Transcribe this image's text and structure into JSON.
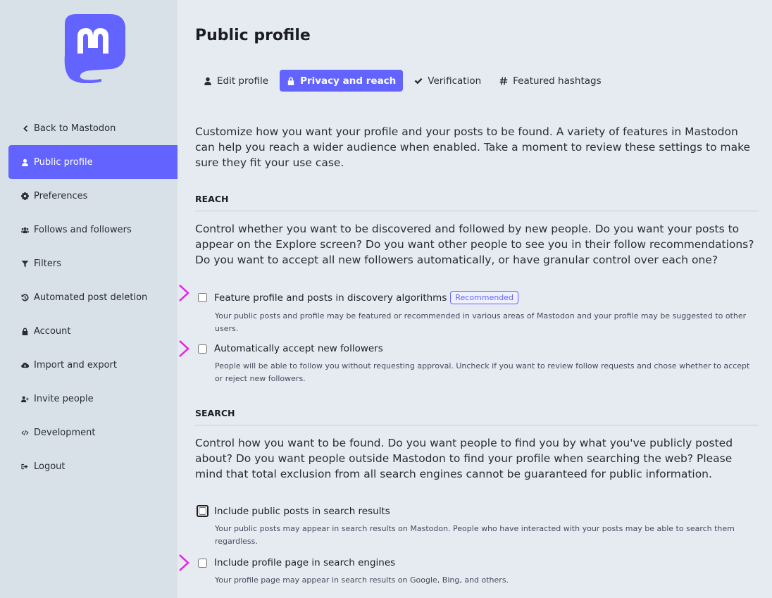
{
  "sidebar": {
    "items": [
      {
        "label": "Back to Mastodon",
        "icon": "chevron-left-icon"
      },
      {
        "label": "Public profile",
        "icon": "user-icon",
        "active": true
      },
      {
        "label": "Preferences",
        "icon": "gear-icon"
      },
      {
        "label": "Follows and followers",
        "icon": "users-icon"
      },
      {
        "label": "Filters",
        "icon": "filter-icon"
      },
      {
        "label": "Automated post deletion",
        "icon": "history-icon"
      },
      {
        "label": "Account",
        "icon": "lock-icon"
      },
      {
        "label": "Import and export",
        "icon": "cloud-download-icon"
      },
      {
        "label": "Invite people",
        "icon": "user-plus-icon"
      },
      {
        "label": "Development",
        "icon": "code-icon"
      },
      {
        "label": "Logout",
        "icon": "sign-out-icon"
      }
    ]
  },
  "page": {
    "title": "Public profile",
    "tabs": [
      {
        "label": "Edit profile",
        "icon": "user-icon"
      },
      {
        "label": "Privacy and reach",
        "icon": "lock-icon",
        "active": true
      },
      {
        "label": "Verification",
        "icon": "check-icon"
      },
      {
        "label": "Featured hashtags",
        "icon": "hashtag-icon"
      }
    ],
    "intro": "Customize how you want your profile and your posts to be found. A variety of features in Mastodon can help you reach a wider audience when enabled. Take a moment to review these settings to make sure they fit your use case."
  },
  "reach": {
    "title": "REACH",
    "description": "Control whether you want to be discovered and followed by new people. Do you want your posts to appear on the Explore screen? Do you want other people to see you in their follow recommendations? Do you want to accept all new followers automatically, or have granular control over each one?",
    "options": [
      {
        "label": "Feature profile and posts in discovery algorithms",
        "badge": "Recommended",
        "hint": "Your public posts and profile may be featured or recommended in various areas of Mastodon and your profile may be suggested to other users.",
        "checked": false
      },
      {
        "label": "Automatically accept new followers",
        "hint": "People will be able to follow you without requesting approval. Uncheck if you want to review follow requests and chose whether to accept or reject new followers.",
        "checked": false
      }
    ]
  },
  "search": {
    "title": "SEARCH",
    "description": "Control how you want to be found. Do you want people to find you by what you've publicly posted about? Do you want people outside Mastodon to find your profile when searching the web? Please mind that total exclusion from all search engines cannot be guaranteed for public information.",
    "options": [
      {
        "label": "Include public posts in search results",
        "hint": "Your public posts may appear in search results on Mastodon. People who have interacted with your posts may be able to search them regardless.",
        "checked": false
      },
      {
        "label": "Include profile page in search engines",
        "hint": "Your profile page may appear in search results on Google, Bing, and others.",
        "checked": false
      }
    ]
  },
  "colors": {
    "accent": "#6364ff",
    "marker": "#e91ee9",
    "sidebar_bg": "#d9e1e8",
    "page_bg": "#e6ebf1"
  }
}
